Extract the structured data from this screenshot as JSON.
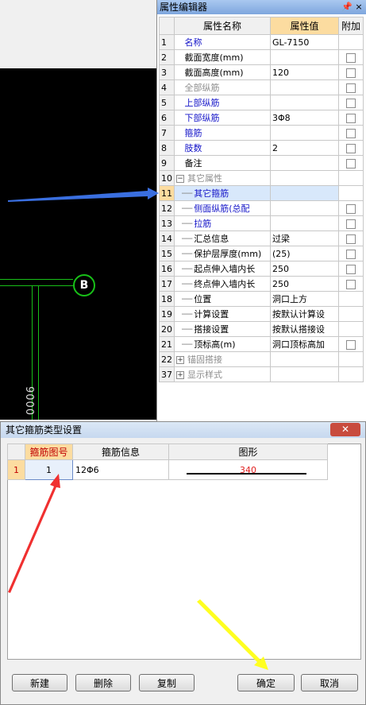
{
  "cad": {
    "bubble_label": "B",
    "dimension_text": "9000"
  },
  "property_editor": {
    "title": "属性编辑器",
    "pin_icon": "pin-icon",
    "close_icon": "close-icon",
    "columns": {
      "name": "属性名称",
      "value": "属性值",
      "extra": "附加"
    },
    "rows": [
      {
        "num": "1",
        "name": "名称",
        "value": "GL-7150",
        "style": "blue",
        "check": false
      },
      {
        "num": "2",
        "name": "截面宽度(mm)",
        "value": "",
        "style": "normal",
        "check": true
      },
      {
        "num": "3",
        "name": "截面高度(mm)",
        "value": "120",
        "style": "normal",
        "check": true
      },
      {
        "num": "4",
        "name": "全部纵筋",
        "value": "",
        "style": "gray",
        "check": true
      },
      {
        "num": "5",
        "name": "上部纵筋",
        "value": "",
        "style": "blue",
        "check": true
      },
      {
        "num": "6",
        "name": "下部纵筋",
        "value": "3Φ8",
        "style": "blue",
        "check": true
      },
      {
        "num": "7",
        "name": "箍筋",
        "value": "",
        "style": "blue",
        "check": true
      },
      {
        "num": "8",
        "name": "肢数",
        "value": "2",
        "style": "blue",
        "check": true
      },
      {
        "num": "9",
        "name": "备注",
        "value": "",
        "style": "normal",
        "check": true
      },
      {
        "num": "10",
        "name": "其它属性",
        "value": "",
        "style": "group-open",
        "check": false
      },
      {
        "num": "11",
        "name": "其它箍筋",
        "value": "",
        "style": "child-blue-selected",
        "check": false
      },
      {
        "num": "12",
        "name": "侧面纵筋(总配",
        "value": "",
        "style": "child-blue",
        "check": true
      },
      {
        "num": "13",
        "name": "拉筋",
        "value": "",
        "style": "child-blue",
        "check": true
      },
      {
        "num": "14",
        "name": "汇总信息",
        "value": "过梁",
        "style": "child",
        "check": true
      },
      {
        "num": "15",
        "name": "保护层厚度(mm)",
        "value": "(25)",
        "style": "child",
        "check": true
      },
      {
        "num": "16",
        "name": "起点伸入墙内长",
        "value": "250",
        "style": "child",
        "check": true
      },
      {
        "num": "17",
        "name": "终点伸入墙内长",
        "value": "250",
        "style": "child",
        "check": true
      },
      {
        "num": "18",
        "name": "位置",
        "value": "洞口上方",
        "style": "child",
        "check": false
      },
      {
        "num": "19",
        "name": "计算设置",
        "value": "按默认计算设",
        "style": "child",
        "check": false
      },
      {
        "num": "20",
        "name": "搭接设置",
        "value": "按默认搭接设",
        "style": "child",
        "check": false
      },
      {
        "num": "21",
        "name": "顶标高(m)",
        "value": "洞口顶标高加",
        "style": "child",
        "check": true
      },
      {
        "num": "22",
        "name": "锚固搭接",
        "value": "",
        "style": "group-closed",
        "check": false
      },
      {
        "num": "37",
        "name": "显示样式",
        "value": "",
        "style": "group-closed",
        "check": false
      }
    ]
  },
  "dialog": {
    "title": "其它箍筋类型设置",
    "close_label": "✕",
    "columns": {
      "shape_no": "箍筋图号",
      "info": "箍筋信息",
      "shape": "图形"
    },
    "rows": [
      {
        "num": "1",
        "shape_no": "1",
        "info": "12Φ6",
        "shape_value": "340"
      }
    ],
    "buttons": {
      "new": "新建",
      "delete": "删除",
      "copy": "复制",
      "ok": "确定",
      "cancel": "取消"
    }
  },
  "colors": {
    "blue_arrow": "#3a6fe0",
    "red_arrow": "#f03030",
    "yellow_arrow": "#ffff20",
    "selection": "#fcdca0"
  }
}
